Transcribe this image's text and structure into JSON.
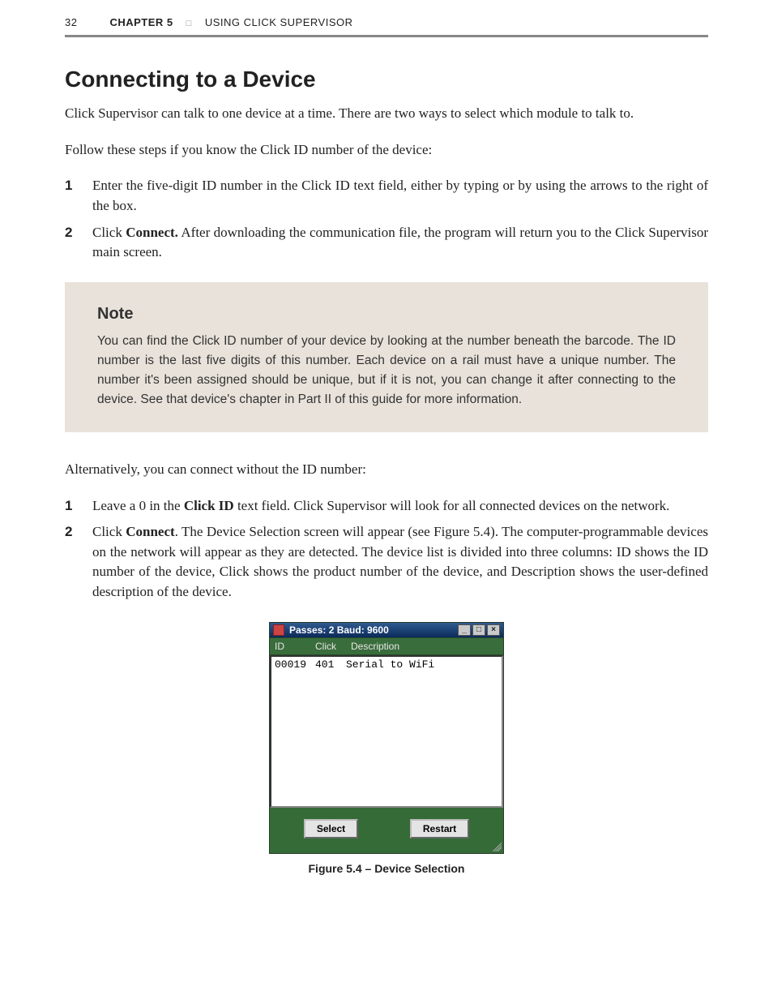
{
  "header": {
    "page_number": "32",
    "chapter_label": "CHAPTER 5",
    "divider_glyph": "□",
    "chapter_title": "USING CLICK SUPERVISOR"
  },
  "section_heading": "Connecting to a Device",
  "intro": "Click Supervisor can talk to one device at a time. There are two ways to select which module to talk to.",
  "lead1": "Follow these steps if you know the Click ID number of the device:",
  "steps_a": [
    {
      "n": "1",
      "text": "Enter the five-digit ID number in the Click ID text field, either by typing or by using the arrows to the right of the box."
    },
    {
      "n": "2",
      "before": "Click ",
      "bold": "Connect.",
      "after": " After downloading the communication file, the program will return you to the Click Supervisor main screen."
    }
  ],
  "note": {
    "heading": "Note",
    "body": "You can find the Click ID number of your device by looking at the number beneath the barcode. The ID number is the last five digits of this number. Each device on a rail must have a unique number. The number it's been assigned should be unique, but if it is not, you can change it after connecting to the device. See that device's chapter in Part II of this guide for more information."
  },
  "lead2": "Alternatively, you can connect without the ID number:",
  "steps_b": [
    {
      "n": "1",
      "before": "Leave a 0 in the ",
      "bold": "Click ID",
      "after": " text field. Click Supervisor will look for all connected devices on the network."
    },
    {
      "n": "2",
      "before": "Click ",
      "bold": "Connect",
      "after": ". The Device Selection screen will appear (see Figure 5.4). The computer-programmable devices on the network will appear as they are detected. The device list is divided into three columns: ID shows the ID number of the device, Click shows the product number of the device, and Description shows the user-defined description of the device."
    }
  ],
  "dialog": {
    "title": "Passes: 2 Baud: 9600",
    "controls": {
      "min": "_",
      "max": "□",
      "close": "×"
    },
    "columns": {
      "id": "ID",
      "click": "Click",
      "desc": "Description"
    },
    "rows": [
      {
        "id": "00019",
        "click": "401",
        "desc": "Serial to WiFi"
      }
    ],
    "buttons": {
      "select": "Select",
      "restart": "Restart"
    }
  },
  "figure_caption": "Figure 5.4 – Device Selection"
}
